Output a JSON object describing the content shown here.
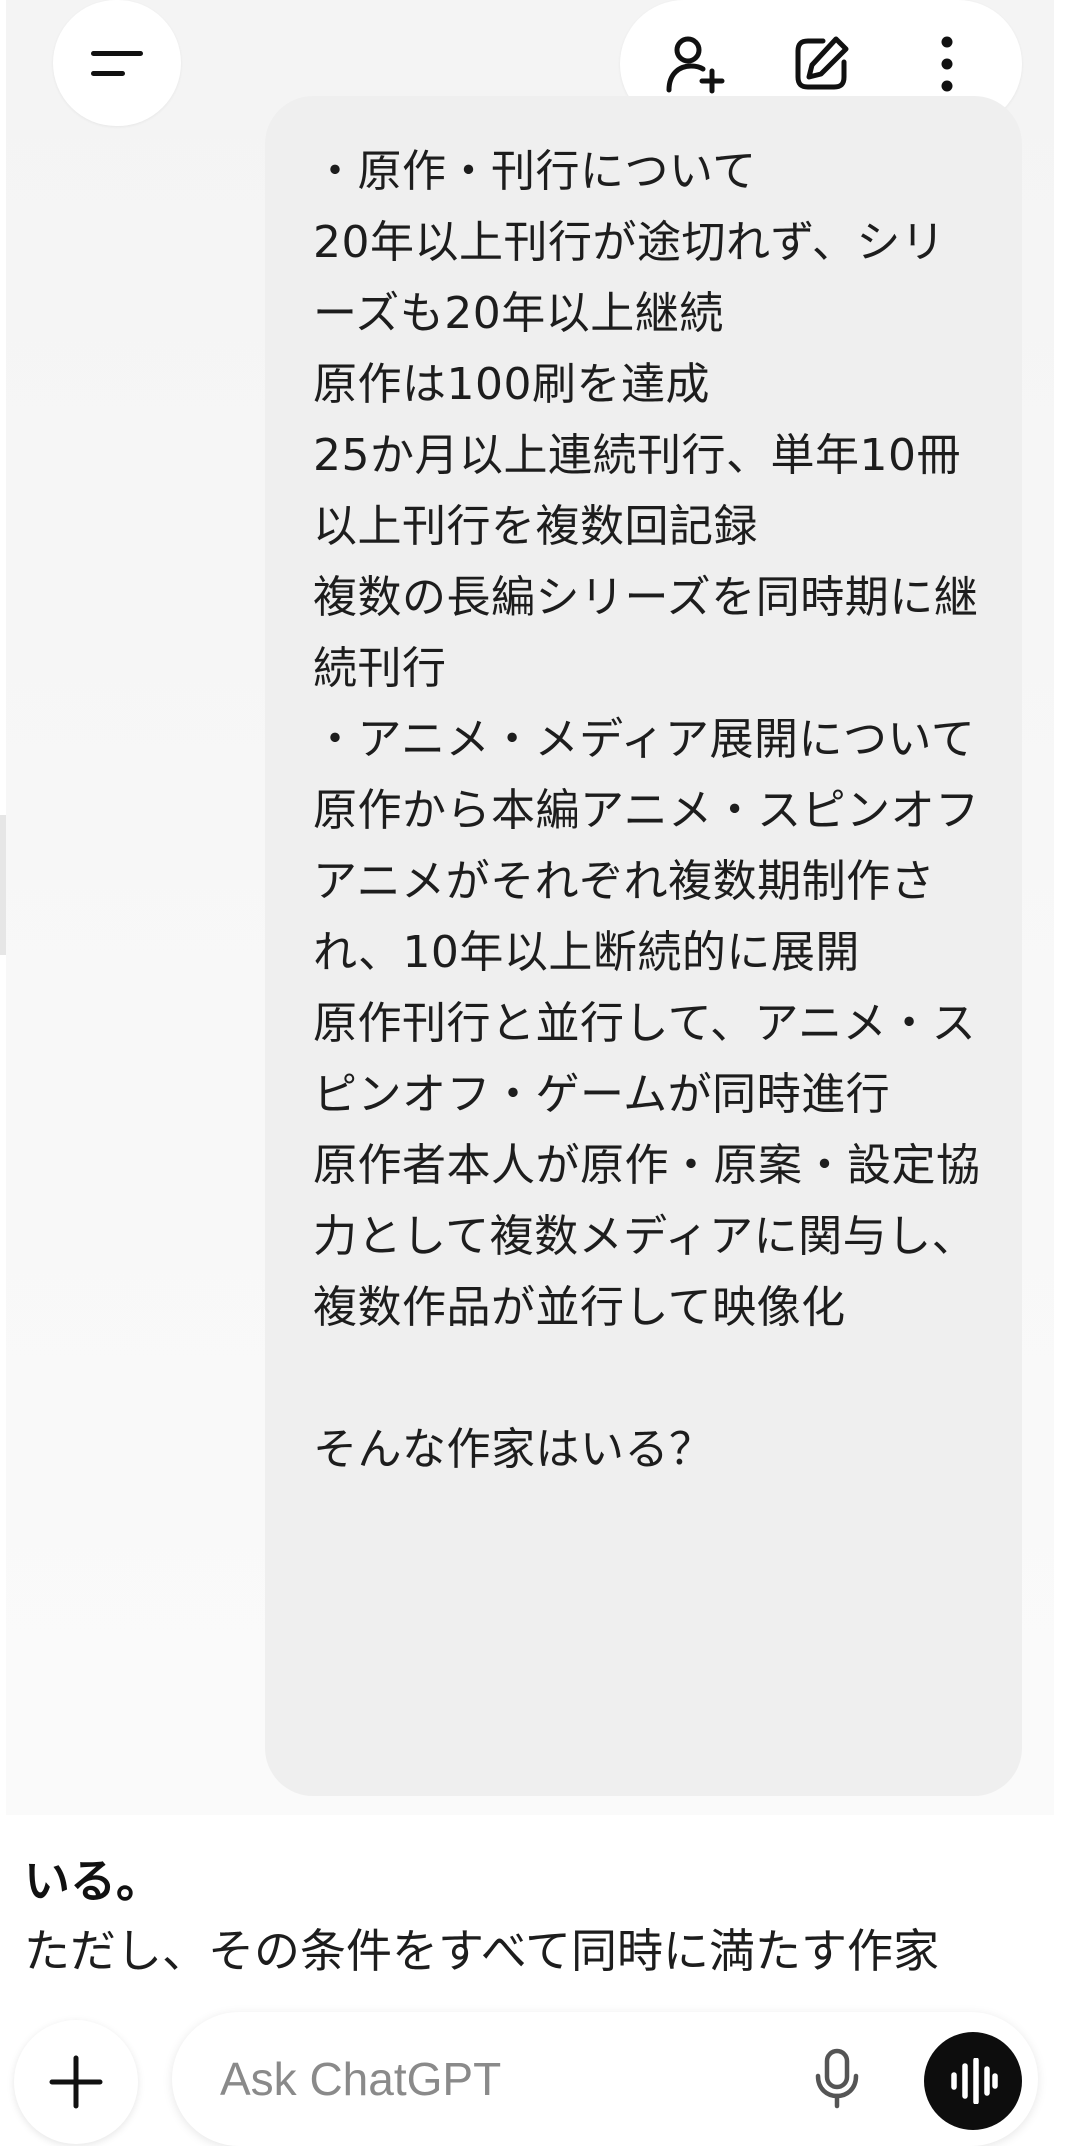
{
  "top_bar": {
    "menu_icon": "hamburger-menu-icon",
    "actions": [
      {
        "icon": "add-person-icon"
      },
      {
        "icon": "edit-icon"
      },
      {
        "icon": "more-vertical-icon"
      }
    ]
  },
  "user_message": {
    "text": "・原作・刊行について\n20年以上刊行が途切れず、シリーズも20年以上継続\n原作は100刷を達成\n25か月以上連続刊行、単年10冊以上刊行を複数回記録\n複数の長編シリーズを同時期に継続刊行\n・アニメ・メディア展開について\n原作から本編アニメ・スピンオフアニメがそれぞれ複数期制作され、10年以上断続的に展開\n原作刊行と並行して、アニメ・スピンオフ・ゲームが同時進行\n原作者本人が原作・原案・設定協力として複数メディアに関与し、複数作品が並行して映像化\n\nそんな作家はいる？"
  },
  "assistant_message": {
    "lead": "いる。",
    "body": "ただし、その条件をすべて同時に満たす作家"
  },
  "composer": {
    "placeholder": "Ask ChatGPT",
    "plus_icon": "plus-icon",
    "mic_icon": "microphone-icon",
    "voice_icon": "voice-mode-icon"
  },
  "colors": {
    "bubble": "#efefef",
    "voice_button": "#0d0d0d",
    "placeholder": "#8a8a8a"
  }
}
